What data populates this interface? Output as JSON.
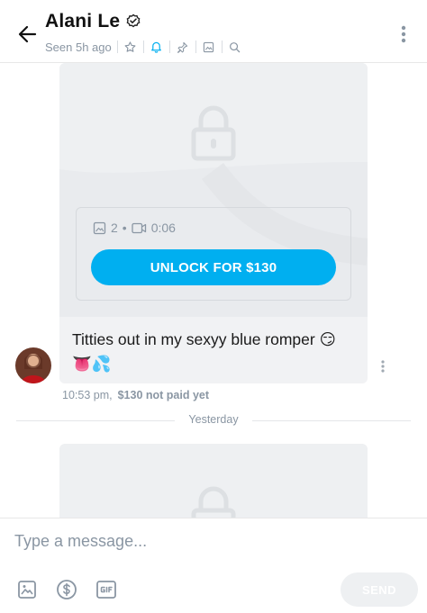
{
  "header": {
    "title": "Alani Le",
    "status": "Seen 5h ago",
    "verified_icon": "verified-badge-icon",
    "actions": [
      "star-icon",
      "bell-icon",
      "pin-icon",
      "gallery-icon",
      "search-icon"
    ],
    "accent_color": "#00aff0"
  },
  "chat": {
    "locked_message": {
      "media_count": "2",
      "separator": "•",
      "video_duration": "0:06",
      "unlock_label": "UNLOCK FOR $130"
    },
    "message": {
      "text": "Titties out in my sexyy blue romper 😏👅💦",
      "time": "10:53 pm,",
      "price_status": "$130 not paid yet"
    },
    "date_divider": "Yesterday"
  },
  "composer": {
    "placeholder": "Type a message...",
    "send_label": "SEND",
    "tools": [
      "image-icon",
      "dollar-icon",
      "gif-icon"
    ]
  }
}
